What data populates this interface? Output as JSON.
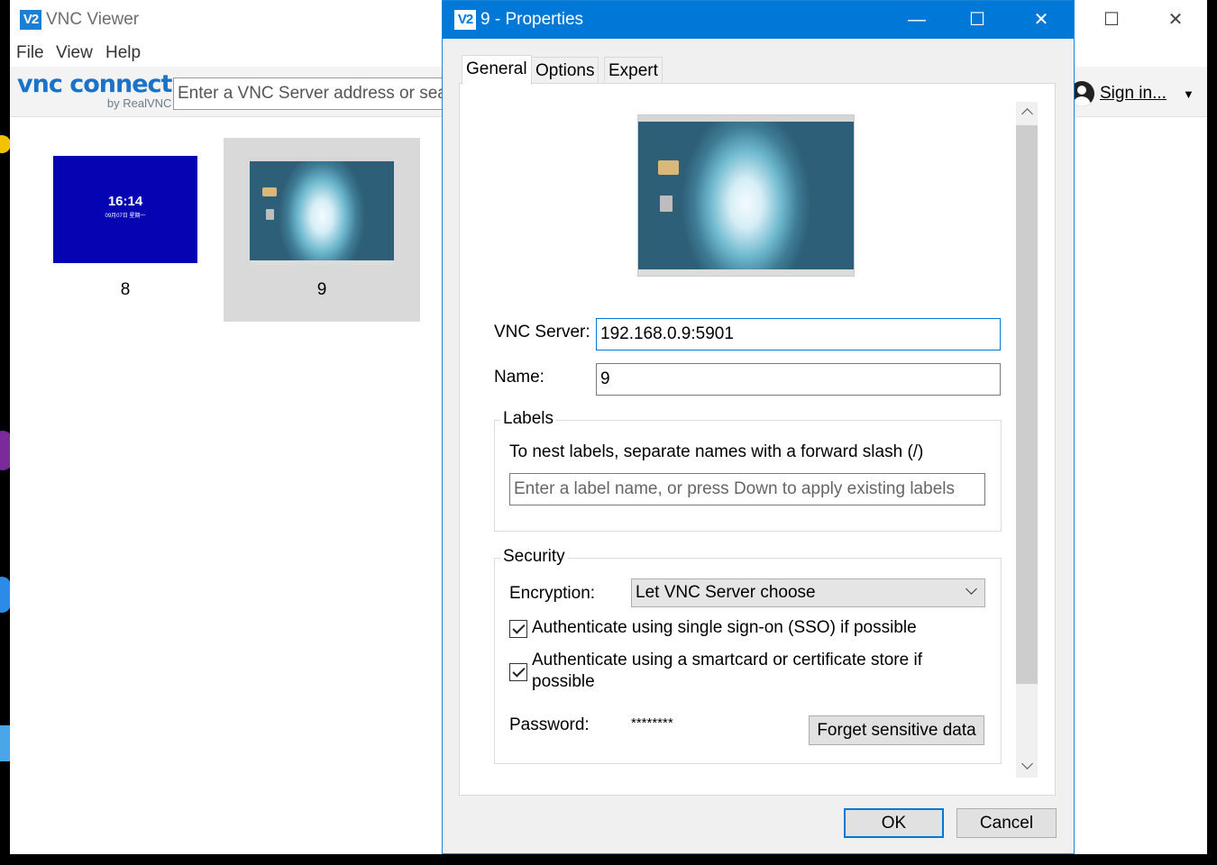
{
  "main_window": {
    "logo_text": "V2",
    "title": "VNC Viewer",
    "minimize_glyph": "—",
    "maximize_glyph": "☐",
    "close_glyph": "✕"
  },
  "menu": {
    "file": "File",
    "view": "View",
    "help": "Help"
  },
  "brand": {
    "name": "vnc connect",
    "sub": "by RealVNC"
  },
  "search": {
    "placeholder": "Enter a VNC Server address or search"
  },
  "account": {
    "sign_in": "Sign in...",
    "caret": "▼"
  },
  "connections": [
    {
      "label": "8",
      "lock_time": "16:14",
      "lock_date": "09月07日 星期一",
      "selected": false
    },
    {
      "label": "9",
      "selected": true
    }
  ],
  "dialog": {
    "logo_text": "V2",
    "title": "9 - Properties",
    "minimize_glyph": "—",
    "maximize_glyph": "☐",
    "close_glyph": "✕",
    "tabs": [
      "General",
      "Options",
      "Expert"
    ],
    "active_tab": "General",
    "vnc_server_label": "VNC Server:",
    "vnc_server_value": "192.168.0.9:5901",
    "name_label": "Name:",
    "name_value": "9",
    "labels_group": {
      "title": "Labels",
      "hint": "To nest labels, separate names with a forward slash (/)",
      "placeholder": "Enter a label name, or press Down to apply existing labels"
    },
    "security_group": {
      "title": "Security",
      "encryption_label": "Encryption:",
      "encryption_value": "Let VNC Server choose",
      "sso_label": "Authenticate using single sign-on (SSO) if possible",
      "sso_checked": true,
      "smartcard_label_line1": "Authenticate using a smartcard or certificate store if",
      "smartcard_label_line2": "possible",
      "smartcard_checked": true,
      "password_label": "Password:",
      "password_value": "********",
      "forget_button": "Forget sensitive data"
    },
    "ok_button": "OK",
    "cancel_button": "Cancel"
  },
  "colors": {
    "dialog_titlebar": "#0078d7",
    "brand": "#1a73c8",
    "lock_screen": "#0504b3",
    "selected_card": "#d9d9d9"
  }
}
